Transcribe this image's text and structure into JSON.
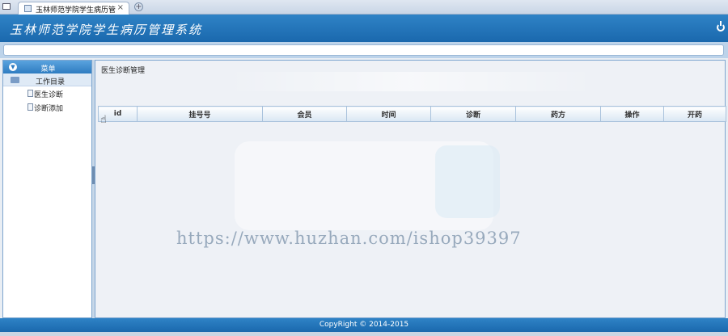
{
  "browser": {
    "tab_title": "玉林师范学院学生病历管...",
    "tab_close": "×",
    "new_tab": "+"
  },
  "header": {
    "app_title": "玉林师范学院学生病历管理系统"
  },
  "sidebar": {
    "menu_label": "菜单",
    "menu_chevron": "▼",
    "group_label": "工作目录",
    "items": [
      {
        "label": "医生诊断"
      },
      {
        "label": "诊断添加"
      }
    ]
  },
  "main": {
    "breadcrumb": "医生诊断管理",
    "table": {
      "columns": [
        "id",
        "挂号号",
        "会员",
        "时间",
        "诊断",
        "药方",
        "操作",
        "开药"
      ]
    },
    "watermark": "https://www.huzhan.com/ishop39397"
  },
  "footer": {
    "copyright": "CopyRight © 2014-2015"
  },
  "colors": {
    "header_blue": "#1a68ad",
    "panel_border": "#7ea6cf"
  }
}
